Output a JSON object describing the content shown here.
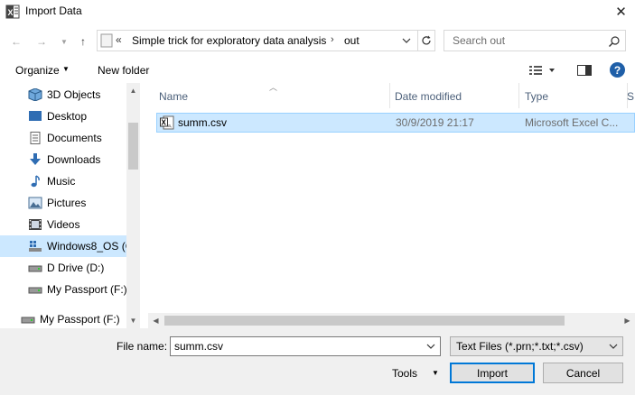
{
  "window": {
    "title": "Import Data",
    "close_glyph": "✕"
  },
  "nav": {
    "back_glyph": "←",
    "forward_glyph": "→",
    "up_glyph": "↑",
    "address": {
      "overflow_glyph": "«",
      "segments": [
        "Simple trick for exploratory data analysis",
        "out"
      ],
      "separator": "›"
    },
    "search_placeholder": "Search out"
  },
  "toolbar": {
    "organize_label": "Organize",
    "new_folder_label": "New folder",
    "help_glyph": "?"
  },
  "sidebar": {
    "items": [
      {
        "label": "3D Objects",
        "icon": "3d-objects-icon"
      },
      {
        "label": "Desktop",
        "icon": "desktop-icon"
      },
      {
        "label": "Documents",
        "icon": "documents-icon"
      },
      {
        "label": "Downloads",
        "icon": "downloads-icon"
      },
      {
        "label": "Music",
        "icon": "music-icon"
      },
      {
        "label": "Pictures",
        "icon": "pictures-icon"
      },
      {
        "label": "Videos",
        "icon": "videos-icon"
      },
      {
        "label": "Windows8_OS (C",
        "icon": "windows-drive-icon",
        "selected": true
      },
      {
        "label": "D Drive (D:)",
        "icon": "drive-icon"
      },
      {
        "label": "My Passport (F:)",
        "icon": "drive-icon"
      }
    ],
    "bottom_item": {
      "label": "My Passport (F:)",
      "icon": "drive-icon"
    }
  },
  "file_list": {
    "columns": [
      "Name",
      "Date modified",
      "Type",
      "S"
    ],
    "rows": [
      {
        "name": "summ.csv",
        "date": "30/9/2019 21:17",
        "type": "Microsoft Excel C...",
        "icon": "excel-csv-icon",
        "selected": true
      }
    ]
  },
  "footer": {
    "file_name_label": "File name:",
    "file_name_value": "summ.csv",
    "file_type_value": "Text Files (*.prn;*.txt;*.csv)",
    "tools_label": "Tools",
    "import_label": "Import",
    "cancel_label": "Cancel"
  },
  "colors": {
    "accent": "#0078d7",
    "selection": "#cce8ff",
    "help": "#1f5fa8"
  }
}
